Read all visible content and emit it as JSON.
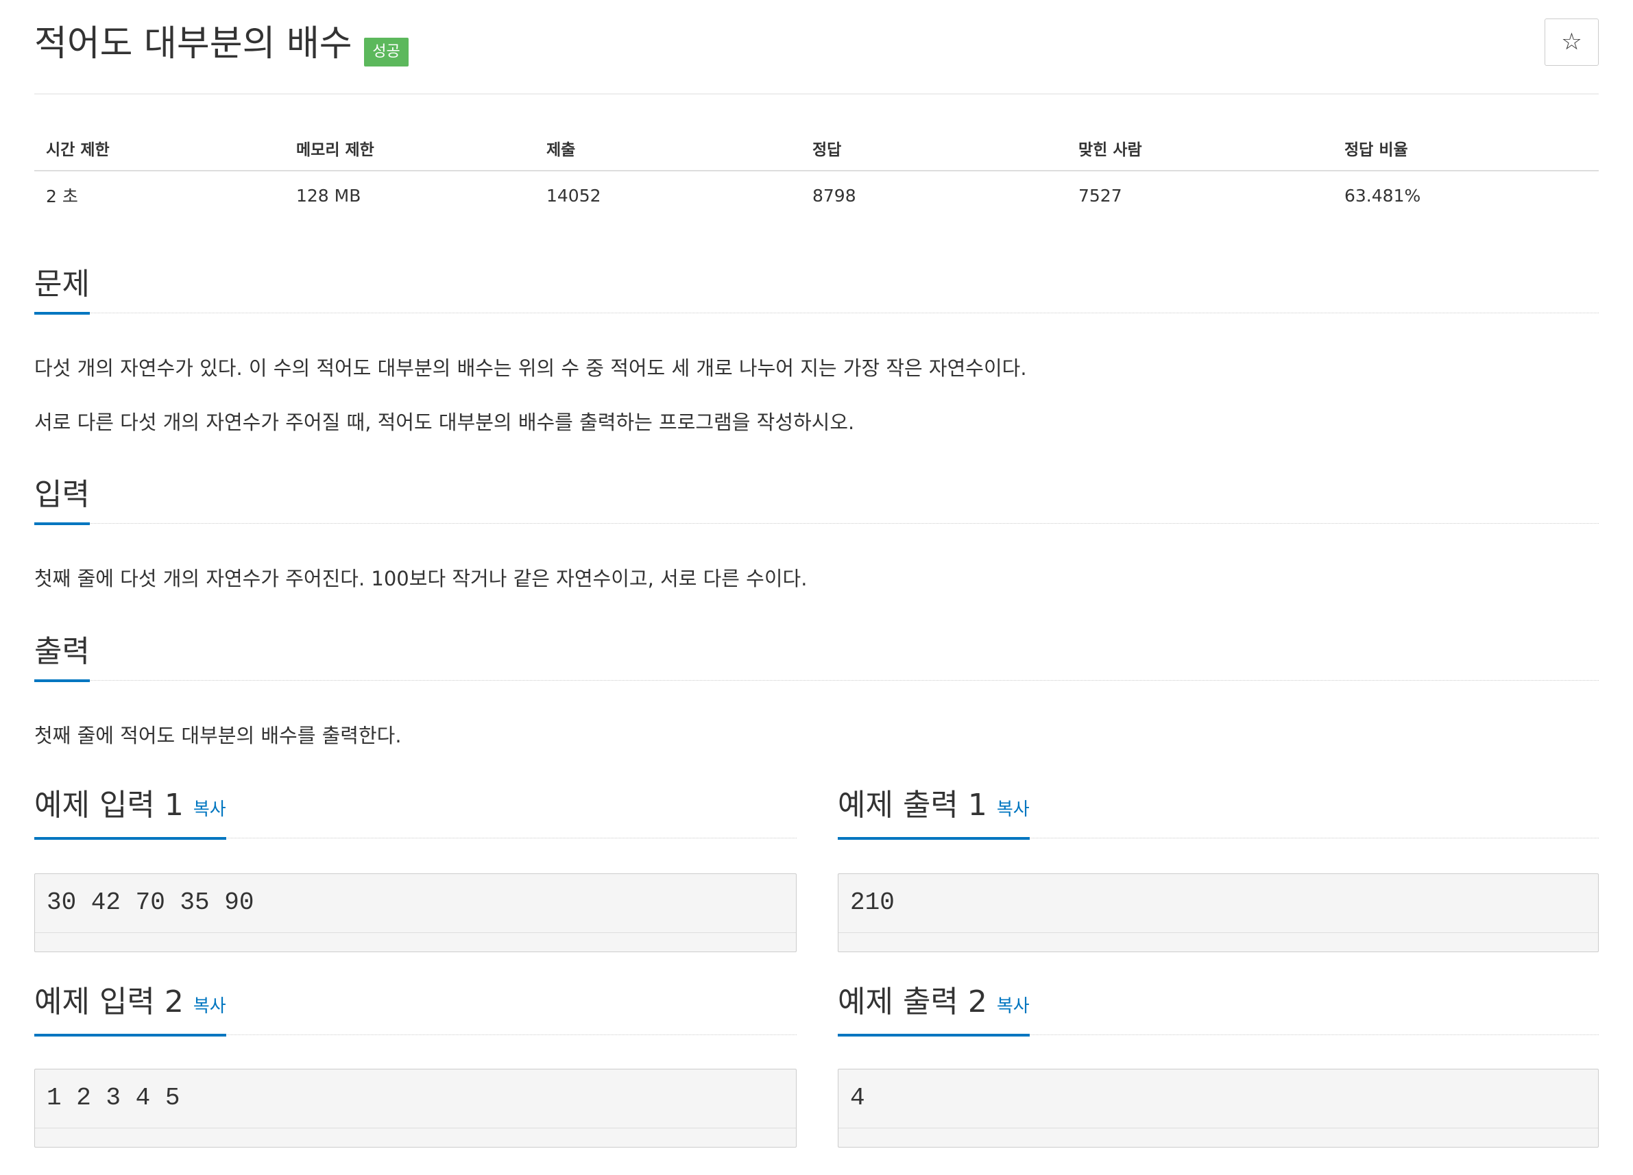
{
  "problem": {
    "title": "적어도 대부분의 배수",
    "badge": "성공",
    "star_icon": "star-icon",
    "star_glyph": "☆"
  },
  "stats": {
    "headers": [
      "시간 제한",
      "메모리 제한",
      "제출",
      "정답",
      "맞힌 사람",
      "정답 비율"
    ],
    "values": [
      "2 초",
      "128 MB",
      "14052",
      "8798",
      "7527",
      "63.481%"
    ]
  },
  "sections": {
    "description": {
      "heading": "문제",
      "paragraphs": [
        "다섯 개의 자연수가 있다. 이 수의 적어도 대부분의 배수는 위의 수 중 적어도 세 개로 나누어 지는 가장 작은 자연수이다.",
        "서로 다른 다섯 개의 자연수가 주어질 때, 적어도 대부분의 배수를 출력하는 프로그램을 작성하시오."
      ]
    },
    "input": {
      "heading": "입력",
      "paragraphs": [
        "첫째 줄에 다섯 개의 자연수가 주어진다. 100보다 작거나 같은 자연수이고, 서로 다른 수이다."
      ]
    },
    "output": {
      "heading": "출력",
      "paragraphs": [
        "첫째 줄에 적어도 대부분의 배수를 출력한다."
      ]
    }
  },
  "samples": [
    {
      "input_heading": "예제 입력 1",
      "output_heading": "예제 출력 1",
      "copy_label": "복사",
      "input": "30 42 70 35 90",
      "output": "210"
    },
    {
      "input_heading": "예제 입력 2",
      "output_heading": "예제 출력 2",
      "copy_label": "복사",
      "input": "1 2 3 4 5",
      "output": "4"
    }
  ],
  "colors": {
    "accent": "#0076c0",
    "success": "#5cb85c"
  }
}
